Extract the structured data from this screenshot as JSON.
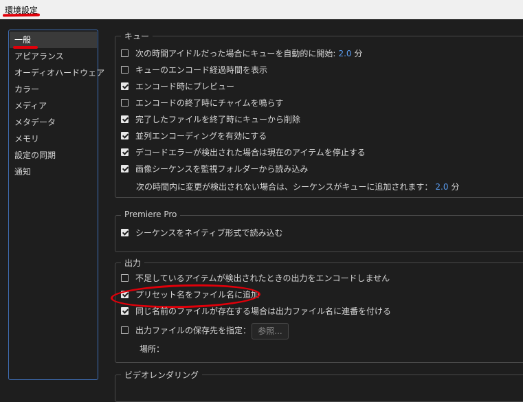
{
  "window": {
    "title": "環境設定"
  },
  "sidebar": {
    "items": [
      {
        "label": "一般",
        "selected": true
      },
      {
        "label": "アピアランス"
      },
      {
        "label": "オーディオハードウェア"
      },
      {
        "label": "カラー"
      },
      {
        "label": "メディア"
      },
      {
        "label": "メタデータ"
      },
      {
        "label": "メモリ"
      },
      {
        "label": "設定の同期"
      },
      {
        "label": "通知"
      }
    ]
  },
  "queue": {
    "legend": "キュー",
    "items": [
      {
        "label": "次の時間アイドルだった場合にキューを自動的に開始:",
        "checked": false,
        "value": "2.0",
        "unit": "分"
      },
      {
        "label": "キューのエンコード経過時間を表示",
        "checked": false
      },
      {
        "label": "エンコード時にプレビュー",
        "checked": true
      },
      {
        "label": "エンコードの終了時にチャイムを鳴らす",
        "checked": false
      },
      {
        "label": "完了したファイルを終了時にキューから削除",
        "checked": true
      },
      {
        "label": "並列エンコーディングを有効にする",
        "checked": true
      },
      {
        "label": "デコードエラーが検出された場合は現在のアイテムを停止する",
        "checked": true
      },
      {
        "label": "画像シーケンスを監視フォルダーから読み込み",
        "checked": true
      }
    ],
    "sequence_note": {
      "label": "次の時間内に変更が検出されない場合は、シーケンスがキューに追加されます：",
      "value": "2.0",
      "unit": "分"
    }
  },
  "premiere": {
    "legend": "Premiere Pro",
    "items": [
      {
        "label": "シーケンスをネイティブ形式で読み込む",
        "checked": true
      }
    ]
  },
  "output": {
    "legend": "出力",
    "items": [
      {
        "label": "不足しているアイテムが検出されたときの出力をエンコードしません",
        "checked": false
      },
      {
        "label": "プリセット名をファイル名に追加",
        "checked": true
      },
      {
        "label": "同じ名前のファイルが存在する場合は出力ファイル名に連番を付ける",
        "checked": true
      },
      {
        "label": "出力ファイルの保存先を指定：",
        "checked": false
      }
    ],
    "browse_label": "参照...",
    "location_label": "場所："
  },
  "next_section": {
    "legend": "ビデオレンダリング"
  },
  "colors": {
    "accent_blue": "#5a9cf0",
    "annotation_red": "#e0000a",
    "background": "#1e1e1e"
  }
}
